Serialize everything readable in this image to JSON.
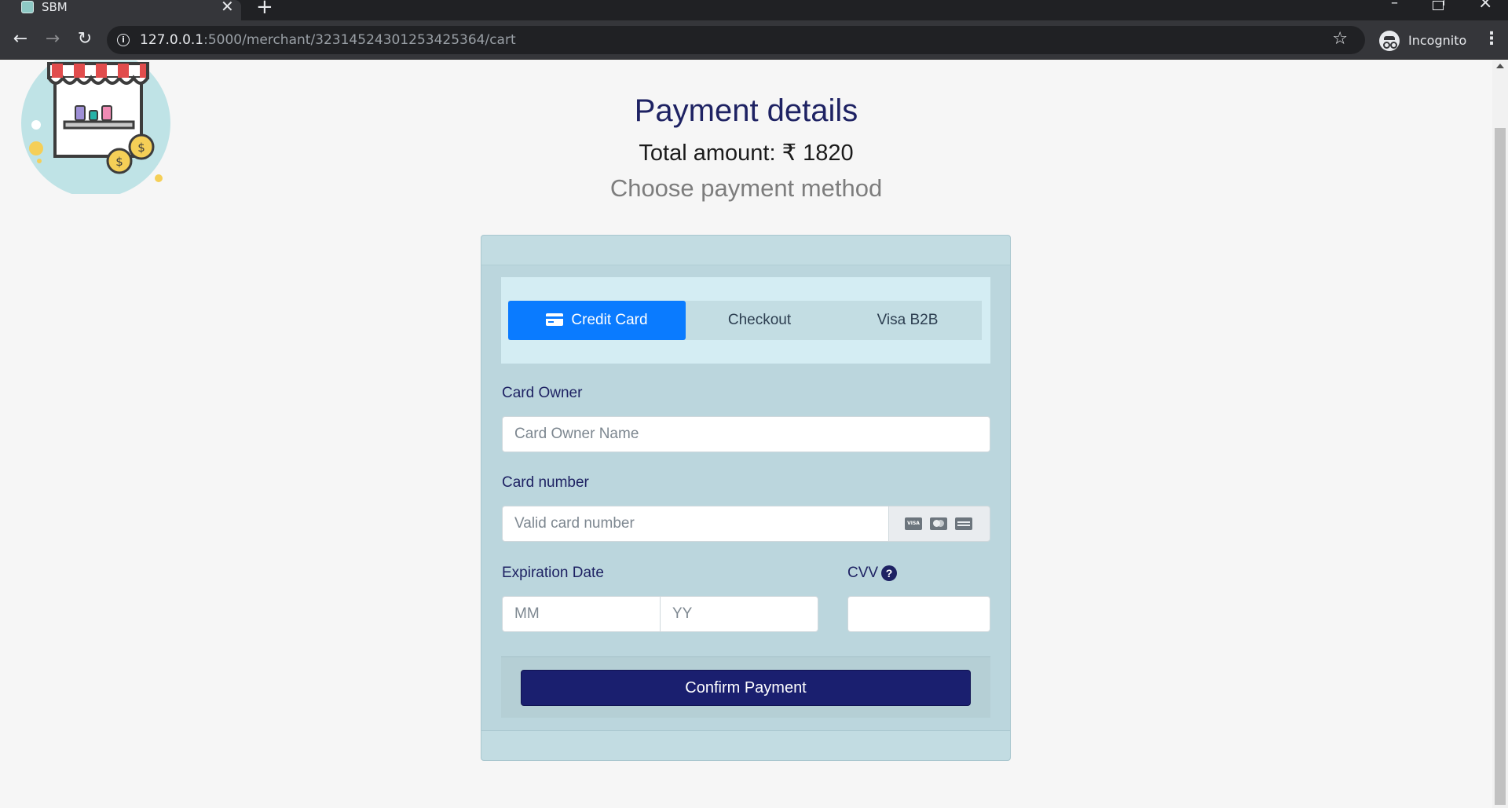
{
  "browser": {
    "tab_title": "SBM",
    "tab_close": "✕",
    "new_tab": "+",
    "url_host": "127.0.0.1",
    "url_rest": ":5000/merchant/32314524301253425364/cart",
    "profile_label": "Incognito"
  },
  "page": {
    "title": "Payment details",
    "total_amount": "Total amount: ₹ 1820",
    "subtitle": "Choose payment method"
  },
  "payment_tabs": [
    {
      "label": "Credit Card",
      "active": true
    },
    {
      "label": "Checkout",
      "active": false
    },
    {
      "label": "Visa B2B",
      "active": false
    }
  ],
  "form": {
    "card_owner_label": "Card Owner",
    "card_owner_placeholder": "Card Owner Name",
    "card_number_label": "Card number",
    "card_number_placeholder": "Valid card number",
    "card_brand_icons": [
      "visa-icon",
      "mastercard-icon",
      "amex-icon"
    ],
    "expiration_label": "Expiration Date",
    "month_placeholder": "MM",
    "year_placeholder": "YY",
    "cvv_label": "CVV",
    "cvv_placeholder": "",
    "confirm_label": "Confirm Payment"
  },
  "colors": {
    "accent": "#0a7bff",
    "primary_dark": "#1a1f6f",
    "heading": "#1e2263",
    "card_bg": "#bbd6dd"
  }
}
